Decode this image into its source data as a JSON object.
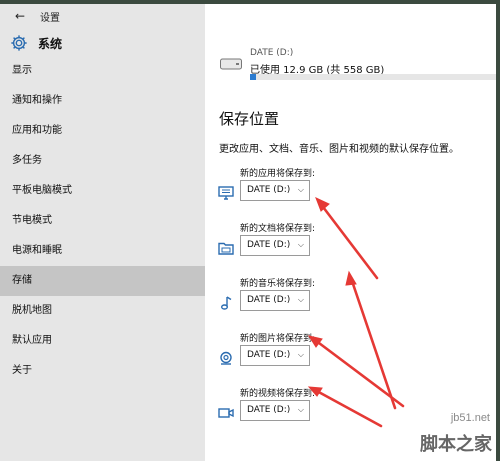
{
  "window": {
    "title": "设置"
  },
  "header": {
    "title": "系统"
  },
  "nav": {
    "items": [
      {
        "label": "显示",
        "selected": false
      },
      {
        "label": "通知和操作",
        "selected": false
      },
      {
        "label": "应用和功能",
        "selected": false
      },
      {
        "label": "多任务",
        "selected": false
      },
      {
        "label": "平板电脑模式",
        "selected": false
      },
      {
        "label": "节电模式",
        "selected": false
      },
      {
        "label": "电源和睡眠",
        "selected": false
      },
      {
        "label": "存储",
        "selected": true
      },
      {
        "label": "脱机地图",
        "selected": false
      },
      {
        "label": "默认应用",
        "selected": false
      },
      {
        "label": "关于",
        "selected": false
      }
    ]
  },
  "drive": {
    "name": "DATE (D:)",
    "used_text": "已使用 12.9 GB (共 558 GB)",
    "used_fraction": 0.023
  },
  "save_locations": {
    "title": "保存位置",
    "description": "更改应用、文档、音乐、图片和视频的默认保存位置。",
    "rows": [
      {
        "label": "新的应用将保存到:",
        "value": "DATE (D:)",
        "icon": "monitor-icon"
      },
      {
        "label": "新的文档将保存到:",
        "value": "DATE (D:)",
        "icon": "folder-icon"
      },
      {
        "label": "新的音乐将保存到:",
        "value": "DATE (D:)",
        "icon": "music-note-icon"
      },
      {
        "label": "新的图片将保存到:",
        "value": "DATE (D:)",
        "icon": "camera-icon"
      },
      {
        "label": "新的视频将保存到:",
        "value": "DATE (D:)",
        "icon": "video-camera-icon"
      }
    ]
  },
  "watermark": {
    "site": "jb51.net",
    "brand": "脚本之家"
  },
  "colors": {
    "accent": "#2b7bd0",
    "annotation": "#e53935",
    "sidebar": "#e6e6e6",
    "selected": "#c5c5c5"
  }
}
